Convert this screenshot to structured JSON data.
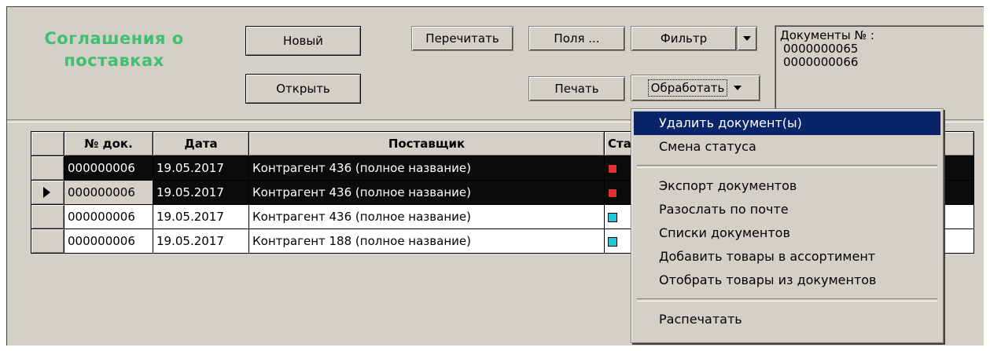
{
  "title": "Соглашения о поставках",
  "toolbar": {
    "new_label": "Новый",
    "reread_label": "Перечитать",
    "fields_label": "Поля ...",
    "filter_label": "Фильтр",
    "open_label": "Открыть",
    "print_label": "Печать",
    "process_label": "Обработать"
  },
  "docs_panel": {
    "label": "Документы № :",
    "numbers": [
      "0000000065",
      "0000000066"
    ]
  },
  "grid": {
    "columns": [
      "№ док.",
      "Дата",
      "Поставщик",
      "Стату"
    ],
    "rows": [
      {
        "num": "000000006",
        "date": "19.05.2017",
        "supplier": "Контрагент 436 (полное название)",
        "status_color": "#e03030",
        "state": "selected"
      },
      {
        "num": "000000006",
        "date": "19.05.2017",
        "supplier": "Контрагент 436 (полное название)",
        "status_color": "#e03030",
        "state": "current"
      },
      {
        "num": "000000006",
        "date": "19.05.2017",
        "supplier": "Контрагент 436 (полное название)",
        "status_color": "#22c8d8",
        "state": "normal"
      },
      {
        "num": "000000006",
        "date": "19.05.2017",
        "supplier": "Контрагент 188 (полное название)",
        "status_color": "#22c8d8",
        "state": "normal"
      }
    ]
  },
  "context_menu": {
    "items": [
      "Удалить документ(ы)",
      "Смена статуса",
      "Экспорт документов",
      "Разослать по почте",
      "Списки документов",
      "Добавить товары в ассортимент",
      "Отобрать товары из документов",
      "Распечатать"
    ],
    "highlighted": "Удалить документ(ы)"
  },
  "colors": {
    "title_green": "#3fbf6f",
    "menu_highlight": "#0a246a",
    "status_red": "#e03030",
    "status_cyan": "#22c8d8"
  }
}
